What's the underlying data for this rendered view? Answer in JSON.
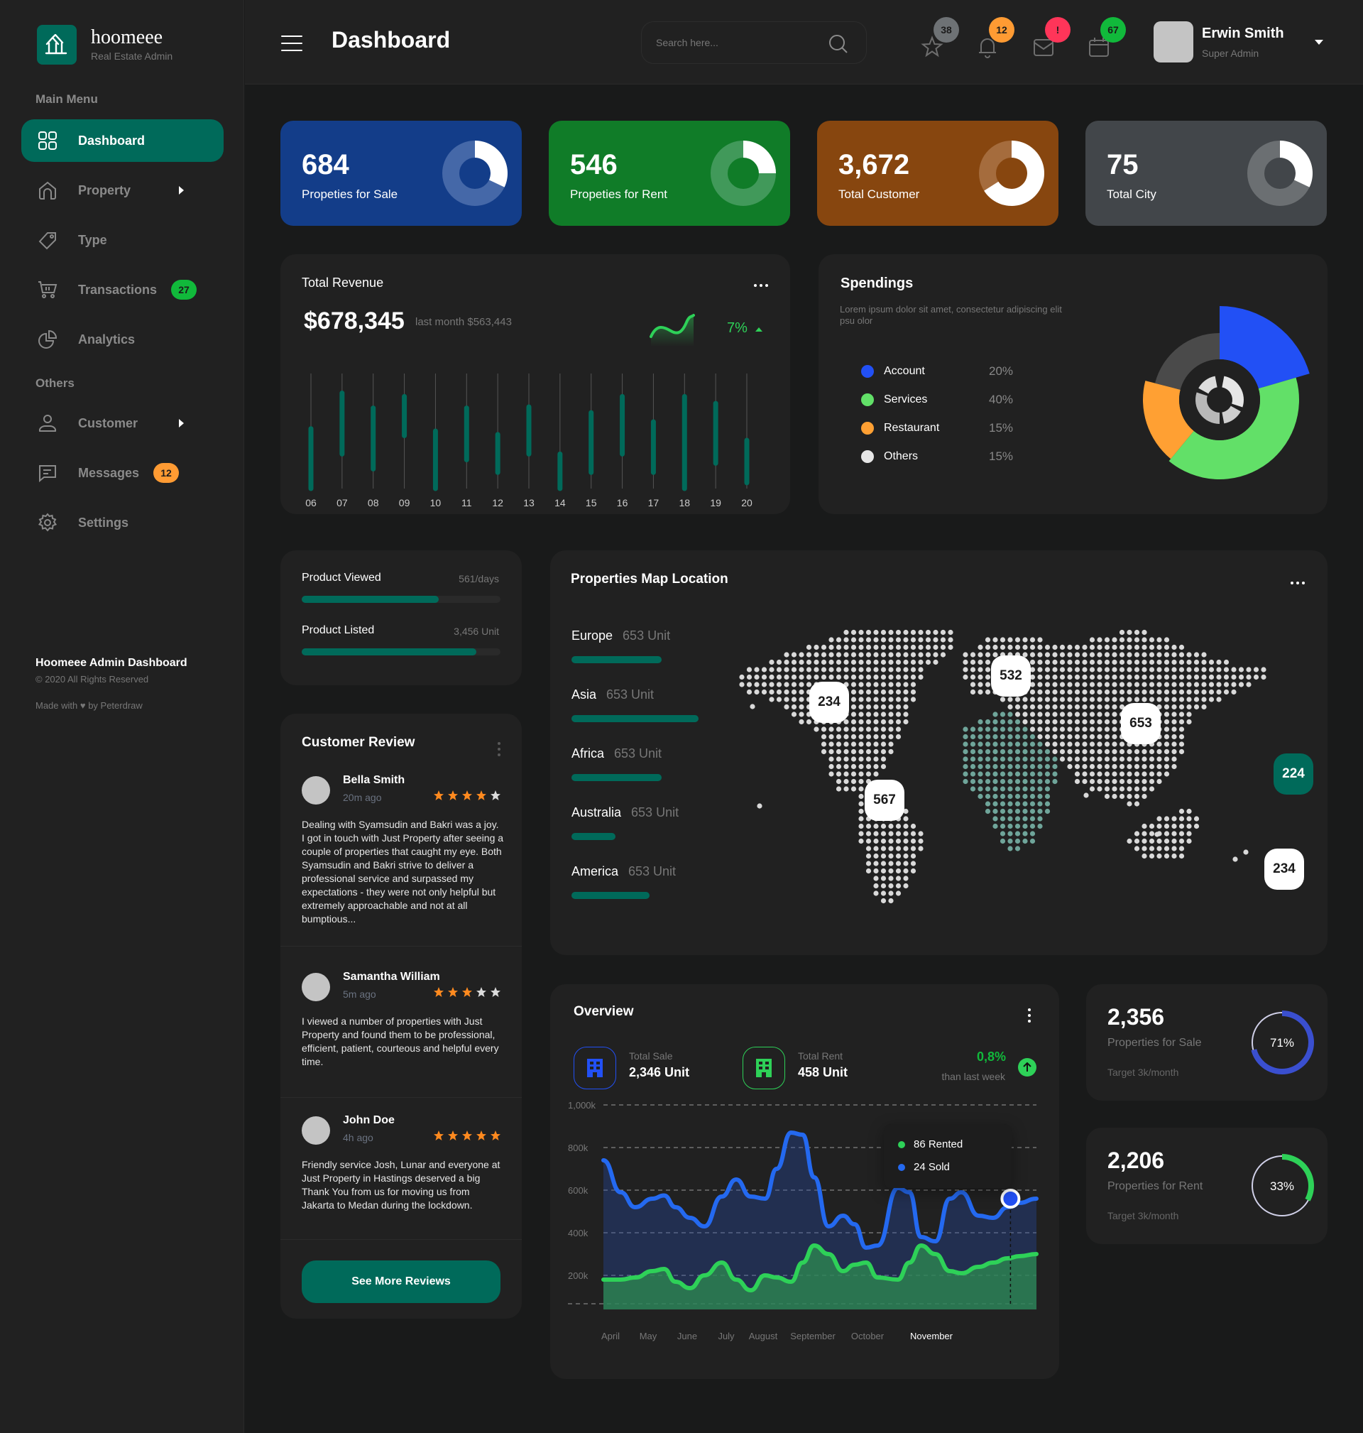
{
  "brand": {
    "name": "hoomeee",
    "subtitle": "Real Estate Admin"
  },
  "header": {
    "title": "Dashboard",
    "search_placeholder": "Search here...",
    "icons": [
      {
        "name": "favorites",
        "icon": "star-icon",
        "badge": "38",
        "badge_color": "#6e7275"
      },
      {
        "name": "notifications",
        "icon": "bell-icon",
        "badge": "12",
        "badge_color": "#ff9b33"
      },
      {
        "name": "messages",
        "icon": "mail-icon",
        "badge": "!",
        "badge_color": "#ff3559"
      },
      {
        "name": "calendar",
        "icon": "calendar-icon",
        "badge": "67",
        "badge_color": "#11b93b"
      }
    ],
    "user": {
      "name": "Erwin Smith",
      "role": "Super Admin"
    }
  },
  "sidebar": {
    "main_heading": "Main Menu",
    "others_heading": "Others",
    "items": [
      {
        "label": "Dashboard",
        "icon": "grid-icon",
        "active": true
      },
      {
        "label": "Property",
        "icon": "home-icon",
        "has_submenu": true
      },
      {
        "label": "Type",
        "icon": "tag-icon"
      },
      {
        "label": "Transactions",
        "icon": "cart-icon",
        "badge": "27",
        "badge_color": "#11b93b"
      },
      {
        "label": "Analytics",
        "icon": "pie-chart-icon"
      },
      {
        "label": "Customer",
        "icon": "user-icon",
        "has_submenu": true
      },
      {
        "label": "Messages",
        "icon": "chat-icon",
        "badge": "12",
        "badge_color": "#ff9b33"
      },
      {
        "label": "Settings",
        "icon": "gear-icon"
      }
    ],
    "footer": {
      "title": "Hoomeee Admin Dashboard",
      "copyright": "© 2020 All Rights Reserved",
      "made_with": "Made with ♥ by Peterdraw"
    }
  },
  "stats": [
    {
      "value": "684",
      "label": "Propeties for Sale",
      "bg": "#133d89",
      "ring_track": "#4568a8",
      "fill_pct": 32
    },
    {
      "value": "546",
      "label": "Propeties for Rent",
      "bg": "#107c28",
      "ring_track": "#41995a",
      "fill_pct": 25
    },
    {
      "value": "3,672",
      "label": "Total Customer",
      "bg": "#87460f",
      "ring_track": "#a56c3d",
      "fill_pct": 66
    },
    {
      "value": "75",
      "label": "Total City",
      "bg": "#42464a",
      "ring_track": "#6b6f72",
      "fill_pct": 32
    }
  ],
  "revenue": {
    "title": "Total Revenue",
    "amount": "$678,345",
    "last_month": "last month $563,443",
    "change": "7%",
    "trend": "up"
  },
  "spendings": {
    "title": "Spendings",
    "description": "Lorem ipsum dolor sit amet, consectetur adipiscing elit psu olor",
    "legend": [
      {
        "name": "Account",
        "pct": "20%",
        "color": "#2250f5"
      },
      {
        "name": "Services",
        "pct": "40%",
        "color": "#62e068"
      },
      {
        "name": "Restaurant",
        "pct": "15%",
        "color": "#ffa033"
      },
      {
        "name": "Others",
        "pct": "15%",
        "color": "#e6e6e6"
      }
    ]
  },
  "progress": [
    {
      "label": "Product Viewed",
      "value": "561/days",
      "fill_pct": 69
    },
    {
      "label": "Product Listed",
      "value": "3,456 Unit",
      "fill_pct": 88
    }
  ],
  "reviews": {
    "title": "Customer Review",
    "items": [
      {
        "name": "Bella Smith",
        "time": "20m ago",
        "rating": 4,
        "text": "Dealing with Syamsudin and Bakri was a joy. I got in touch with Just Property after seeing a couple of properties that caught my eye. Both Syamsudin and Bakri strive to deliver a professional service and surpassed my expectations - they were not only helpful but extremely approachable and not at all bumptious..."
      },
      {
        "name": "Samantha William",
        "time": "5m ago",
        "rating": 3,
        "text": "I viewed a number of properties with Just Property and found them to be professional, efficient, patient, courteous and helpful every time."
      },
      {
        "name": "John Doe",
        "time": "4h ago",
        "rating": 5,
        "text": "Friendly service Josh, Lunar and everyone at Just Property in Hastings deserved a big Thank You from us for moving us from Jakarta to Medan during the lockdown."
      }
    ],
    "more_label": "See More Reviews"
  },
  "map": {
    "title": "Properties Map Location",
    "regions": [
      {
        "name": "Europe",
        "units": "653 Unit",
        "fill_pct": 55
      },
      {
        "name": "Asia",
        "units": "653 Unit",
        "fill_pct": 78
      },
      {
        "name": "Africa",
        "units": "653 Unit",
        "fill_pct": 55
      },
      {
        "name": "Australia",
        "units": "653 Unit",
        "fill_pct": 27
      },
      {
        "name": "America",
        "units": "653 Unit",
        "fill_pct": 48
      }
    ],
    "pins": [
      {
        "label": "234",
        "region": "north-america"
      },
      {
        "label": "532",
        "region": "europe"
      },
      {
        "label": "653",
        "region": "asia"
      },
      {
        "label": "224",
        "region": "africa",
        "highlight": true
      },
      {
        "label": "567",
        "region": "south-america"
      },
      {
        "label": "234",
        "region": "australia"
      }
    ]
  },
  "overview": {
    "title": "Overview",
    "total_sale_label": "Total Sale",
    "total_sale_value": "2,346 Unit",
    "total_rent_label": "Total Rent",
    "total_rent_value": "458 Unit",
    "change": "0,8%",
    "change_caption": "than last week",
    "tooltip": {
      "rented": "86 Rented",
      "sold": "24 Sold"
    }
  },
  "kpis": [
    {
      "value": "2,356",
      "label": "Properties for Sale",
      "target": "Target 3k/month",
      "pct_label": "71%",
      "pct": 71,
      "color": "#3a4fcf"
    },
    {
      "value": "2,206",
      "label": "Properties for Rent",
      "target": "Target 3k/month",
      "pct_label": "33%",
      "pct": 33,
      "color": "#2ed158"
    }
  ],
  "chart_data": [
    {
      "type": "bar",
      "title": "Total Revenue",
      "subtype": "candlestick-range",
      "categories": [
        "06",
        "07",
        "08",
        "09",
        "10",
        "11",
        "12",
        "13",
        "14",
        "15",
        "16",
        "17",
        "18",
        "19",
        "20"
      ],
      "ranges": [
        [
          0,
          52
        ],
        [
          30,
          83
        ],
        [
          17,
          70
        ],
        [
          46,
          80
        ],
        [
          0,
          50
        ],
        [
          25,
          70
        ],
        [
          14,
          47
        ],
        [
          30,
          71
        ],
        [
          0,
          30
        ],
        [
          14,
          66
        ],
        [
          30,
          80
        ],
        [
          14,
          58
        ],
        [
          0,
          80
        ],
        [
          22,
          74
        ],
        [
          5,
          42
        ]
      ],
      "ylim": [
        0,
        100
      ]
    },
    {
      "type": "pie",
      "title": "Spendings",
      "labels": [
        "Account",
        "Services",
        "Restaurant",
        "Others"
      ],
      "values": [
        20,
        40,
        15,
        15
      ]
    },
    {
      "type": "area",
      "title": "Overview",
      "categories": [
        "April",
        "May",
        "June",
        "July",
        "August",
        "September",
        "October",
        "November"
      ],
      "x": [
        0.0,
        0.3,
        0.55,
        0.85,
        1.05,
        1.25,
        1.5,
        1.75,
        2.05,
        2.3,
        2.55,
        2.8,
        3.0,
        3.25,
        3.45,
        3.65,
        3.9,
        4.15,
        4.35,
        4.55,
        4.75,
        5.1,
        5.3,
        5.5,
        5.75,
        6.0,
        6.2,
        6.5,
        6.75,
        7.0,
        7.2,
        7.5
      ],
      "series": [
        {
          "name": "Sold",
          "color": "#2469f0",
          "values": [
            740,
            590,
            520,
            560,
            575,
            520,
            470,
            430,
            570,
            650,
            570,
            560,
            700,
            870,
            860,
            660,
            430,
            480,
            440,
            330,
            340,
            610,
            590,
            380,
            360,
            560,
            590,
            480,
            470,
            520,
            540,
            560
          ]
        },
        {
          "name": "Rented",
          "color": "#2ed158",
          "values": [
            180,
            180,
            190,
            220,
            230,
            170,
            140,
            200,
            260,
            180,
            130,
            200,
            190,
            170,
            260,
            340,
            300,
            220,
            250,
            260,
            190,
            180,
            260,
            340,
            300,
            220,
            210,
            240,
            260,
            280,
            290,
            300
          ]
        }
      ],
      "yticks": [
        "1,000k",
        "800k",
        "600k",
        "400k",
        "200k"
      ],
      "ylim": [
        0,
        1000
      ],
      "grid": true,
      "highlight": {
        "category": "November",
        "rented": 86,
        "sold": 24
      }
    }
  ]
}
